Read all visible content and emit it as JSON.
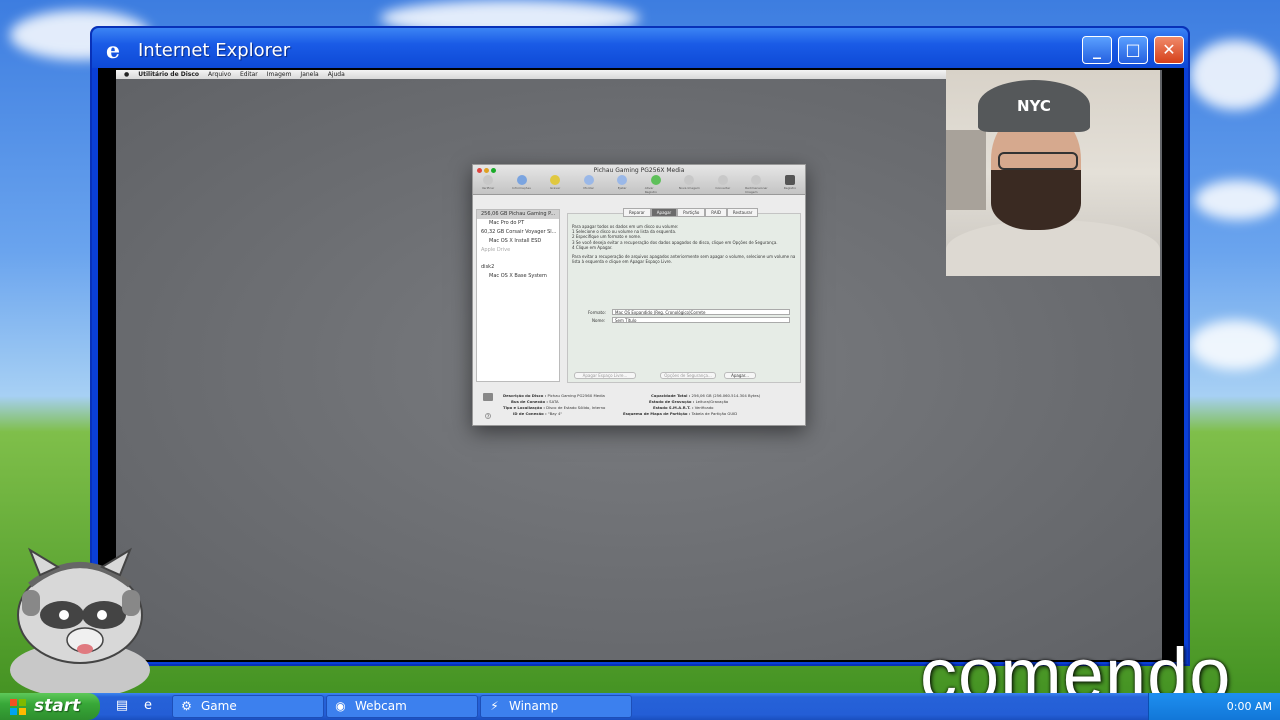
{
  "ie_window": {
    "title": "Internet Explorer",
    "minimize": "_",
    "maximize": "□",
    "close": "✕"
  },
  "mac_menubar": {
    "items": [
      "Utilitário de Disco",
      "Arquivo",
      "Editar",
      "Imagem",
      "Janela",
      "Ajuda"
    ]
  },
  "disk_utility": {
    "title": "Pichau Gaming PG256X Media",
    "toolbar": [
      "Verificar",
      "Informações",
      "Gravar",
      "Montar",
      "Ejetar",
      "Ativar Registro",
      "Nova Imagem",
      "Converter",
      "Redimensionar Imagem",
      "Registro"
    ],
    "sidebar": [
      {
        "label": "256,06 GB Pichau Gaming P...",
        "selected": true,
        "child": false,
        "dim": false
      },
      {
        "label": "Mac Pro do PT",
        "selected": false,
        "child": true,
        "dim": false
      },
      {
        "label": "60,32 GB Corsair Voyager Sl...",
        "selected": false,
        "child": false,
        "dim": false
      },
      {
        "label": "Mac OS X Install ESD",
        "selected": false,
        "child": true,
        "dim": false
      },
      {
        "label": "Apple Drive",
        "selected": false,
        "child": false,
        "dim": true
      },
      {
        "label": "disk2",
        "selected": false,
        "child": false,
        "dim": false
      },
      {
        "label": "Mac OS X Base System",
        "selected": false,
        "child": true,
        "dim": false
      }
    ],
    "tabs": [
      "Reparar",
      "Apagar",
      "Partição",
      "RAID",
      "Restaurar"
    ],
    "active_tab": "Apagar",
    "instructions": [
      "Para apagar todos os dados em um disco ou volume:",
      "1 Selecione o disco ou volume na lista da esquerda.",
      "2 Especifique um formato e nome.",
      "3 Se você deseja evitar a recuperação dos dados apagados do disco, clique em Opções de Segurança.",
      "4 Clique em Apagar.",
      "Para evitar a recuperação de arquivos apagados anteriormente sem apagar o volume, selecione um volume na lista à esquerda e clique em Apagar Espaço Livre."
    ],
    "format_label": "Formato:",
    "format_value": "Mac OS Expandido (Reg. Cronológico)Correte",
    "name_label": "Nome:",
    "name_value": "Sem Título",
    "btn_erase_free": "Apagar Espaço Livre...",
    "btn_security": "Opções de Segurança...",
    "btn_erase": "Apagar...",
    "info": {
      "desc_label": "Descrição do Disco :",
      "desc_value": "Pichau Gaming PG256X Media",
      "bus_label": "Bus de Conexão :",
      "bus_value": "SATA",
      "type_label": "Tipo e Localização :",
      "type_value": "Disco de Estado Sólido, Interno",
      "id_label": "ID de Conexão :",
      "id_value": "\"Bay 4\"",
      "cap_label": "Capacidade Total :",
      "cap_value": "256,06 GB (256.060.514.304 Bytes)",
      "write_label": "Estado de Gravação :",
      "write_value": "Leitura/Gravação",
      "smart_label": "Estado S.M.A.R.T. :",
      "smart_value": "Verificado",
      "scheme_label": "Esquema de Mapa de Partição :",
      "scheme_value": "Tabela de Partição GUID"
    }
  },
  "webcam": {
    "hat_text": "NYC"
  },
  "taskbar": {
    "start_label": "start",
    "items": [
      {
        "label": "Game",
        "icon": "game-icon"
      },
      {
        "label": "Webcam",
        "icon": "webcam-icon"
      },
      {
        "label": "Winamp",
        "icon": "winamp-icon"
      }
    ],
    "clock": "0:00 AM"
  },
  "overlay_text": "comendo"
}
